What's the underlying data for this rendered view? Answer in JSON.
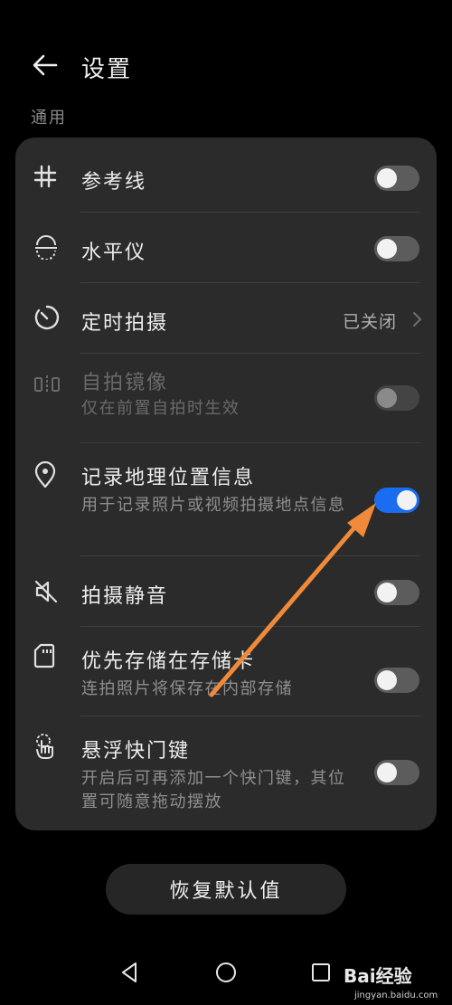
{
  "header": {
    "title": "设置"
  },
  "section": {
    "title": "通用"
  },
  "settings": {
    "gridlines": {
      "label": "参考线",
      "enabled": false
    },
    "level": {
      "label": "水平仪",
      "enabled": false
    },
    "timer": {
      "label": "定时拍摄",
      "value": "已关闭"
    },
    "mirror": {
      "label": "自拍镜像",
      "sub": "仅在前置自拍时生效",
      "enabled": false,
      "disabled": true
    },
    "location": {
      "label": "记录地理位置信息",
      "sub": "用于记录照片或视频拍摄地点信息",
      "enabled": true
    },
    "mute": {
      "label": "拍摄静音",
      "enabled": false
    },
    "sdcard": {
      "label": "优先存储在存储卡",
      "sub": "连拍照片将保存在内部存储",
      "enabled": false
    },
    "floating": {
      "label": "悬浮快门键",
      "sub": "开启后可再添加一个快门键，其位置可随意拖动摆放",
      "enabled": false
    }
  },
  "restore": {
    "label": "恢复默认值"
  },
  "watermark": {
    "text": "Bai经验",
    "url": "jingyan.baidu.com"
  },
  "colors": {
    "accent": "#1a6df0",
    "annotation_arrow": "#f08a3a"
  }
}
